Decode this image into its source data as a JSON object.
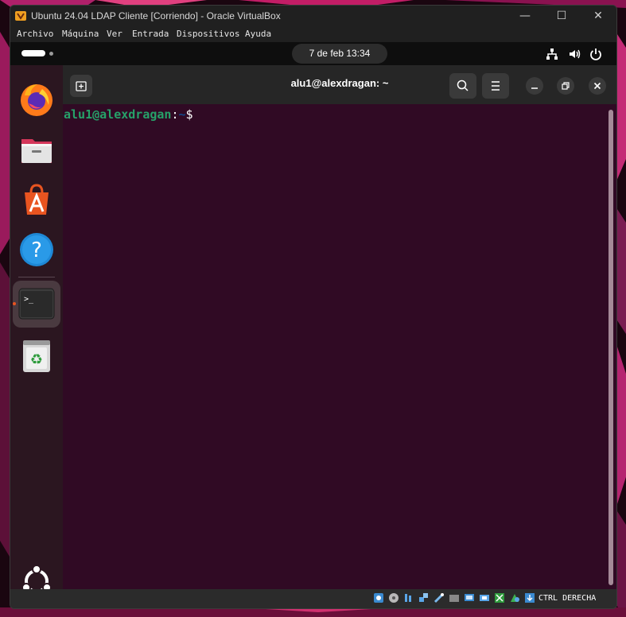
{
  "window": {
    "title": "Ubuntu 24.04 LDAP Cliente [Corriendo] - Oracle VirtualBox",
    "minimize_glyph": "—",
    "maximize_glyph": "☐",
    "close_glyph": "✕"
  },
  "menu": {
    "items": [
      {
        "label": "Archivo"
      },
      {
        "label": "Máquina"
      },
      {
        "label": "Ver"
      },
      {
        "label": "Entrada"
      },
      {
        "label": "Dispositivos"
      },
      {
        "label": "Ayuda"
      }
    ]
  },
  "top_panel": {
    "clock": "7 de feb  13:34",
    "tray_icons": [
      "network-icon",
      "volume-icon",
      "power-icon"
    ]
  },
  "dock": {
    "items": [
      {
        "name": "firefox",
        "icon": "firefox-icon"
      },
      {
        "name": "files",
        "icon": "folder-icon"
      },
      {
        "name": "app-center",
        "icon": "app-center-icon"
      },
      {
        "name": "help",
        "icon": "help-icon"
      },
      {
        "name": "terminal",
        "icon": "terminal-icon",
        "running": true
      },
      {
        "name": "trash",
        "icon": "trash-icon"
      }
    ],
    "show_apps_icon": "ubuntu-logo-icon",
    "terminal_glyph": ">_",
    "help_glyph": "?",
    "trash_glyph": "♻"
  },
  "terminal": {
    "title": "alu1@alexdragan: ~",
    "prompt": {
      "user_host": "alu1@alexdragan",
      "colon": ":",
      "path": "~",
      "symbol": "$"
    },
    "colors": {
      "background": "#300a24",
      "prompt_user": "#26a269",
      "prompt_path": "#12488b"
    }
  },
  "status_bar": {
    "host_key": "CTRL DERECHA",
    "icons": [
      "hard-disk-icon",
      "optical-drive-icon",
      "audio-icon",
      "network-adapters-icon",
      "usb-icon",
      "shared-folders-icon",
      "display-icon",
      "recording-icon",
      "virtualization-icon",
      "mouse-integration-icon",
      "keyboard-icon"
    ]
  }
}
